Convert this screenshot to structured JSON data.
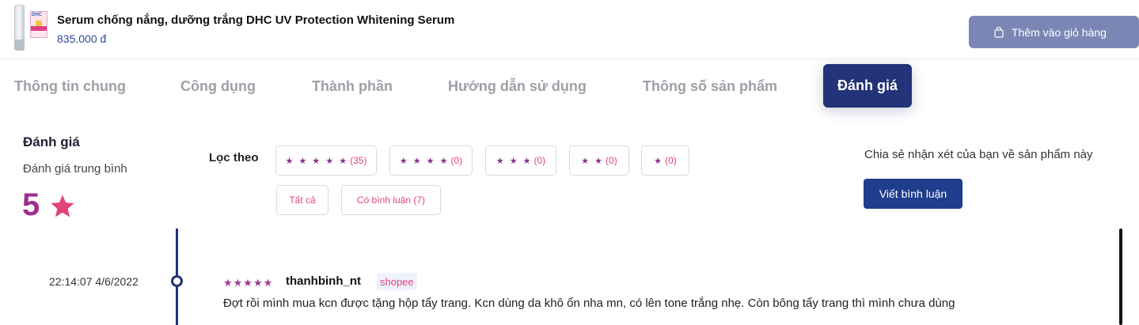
{
  "product": {
    "name": "Serum chống nắng, dưỡng trắng DHC UV Protection Whitening Serum",
    "price": "835.000 đ",
    "thumb_logo": "DHC",
    "add_to_cart_label": "Thêm vào giỏ hàng"
  },
  "tabs": [
    {
      "label": "Thông tin chung",
      "active": false
    },
    {
      "label": "Công dụng",
      "active": false
    },
    {
      "label": "Thành phần",
      "active": false
    },
    {
      "label": "Hướng dẫn sử dụng",
      "active": false
    },
    {
      "label": "Thông số sản phẩm",
      "active": false
    },
    {
      "label": "Đánh giá",
      "active": true
    }
  ],
  "reviews": {
    "title": "Đánh giá",
    "average_label": "Đánh giá trung bình",
    "average_score": "5",
    "filter_label": "Lọc theo",
    "filters": [
      {
        "stars": "★ ★ ★ ★ ★",
        "count": "(35)"
      },
      {
        "stars": "★ ★ ★ ★",
        "count": "(0)"
      },
      {
        "stars": "★ ★ ★",
        "count": "(0)"
      },
      {
        "stars": "★ ★",
        "count": "(0)"
      },
      {
        "stars": "★",
        "count": "(0)"
      }
    ],
    "filter_all": "Tất cả",
    "filter_with_comment": "Có bình luận (7)",
    "share_prompt": "Chia sẻ nhận xét của bạn về sản phẩm này",
    "write_button": "Viết bình luận",
    "items": [
      {
        "date": "22:14:07 4/6/2022",
        "stars": "★★★★★",
        "rating": 5,
        "user": "thanhbinh_nt",
        "source": "shopee",
        "text": "Đợt rồi mình mua kcn được tặng hộp tẩy trang. Kcn dùng da khô ổn nha mn, có lên tone trắng nhẹ. Còn bông tẩy trang thì mình chưa dùng"
      }
    ]
  },
  "colors": {
    "primary": "#233377",
    "cart_button": "#7a86b4",
    "accent_pink": "#e0457b",
    "score_purple": "#a02d8e",
    "write_button": "#1f3d8c"
  },
  "icons": [
    "bag-icon",
    "star-icon",
    "timeline-dot-icon"
  ]
}
